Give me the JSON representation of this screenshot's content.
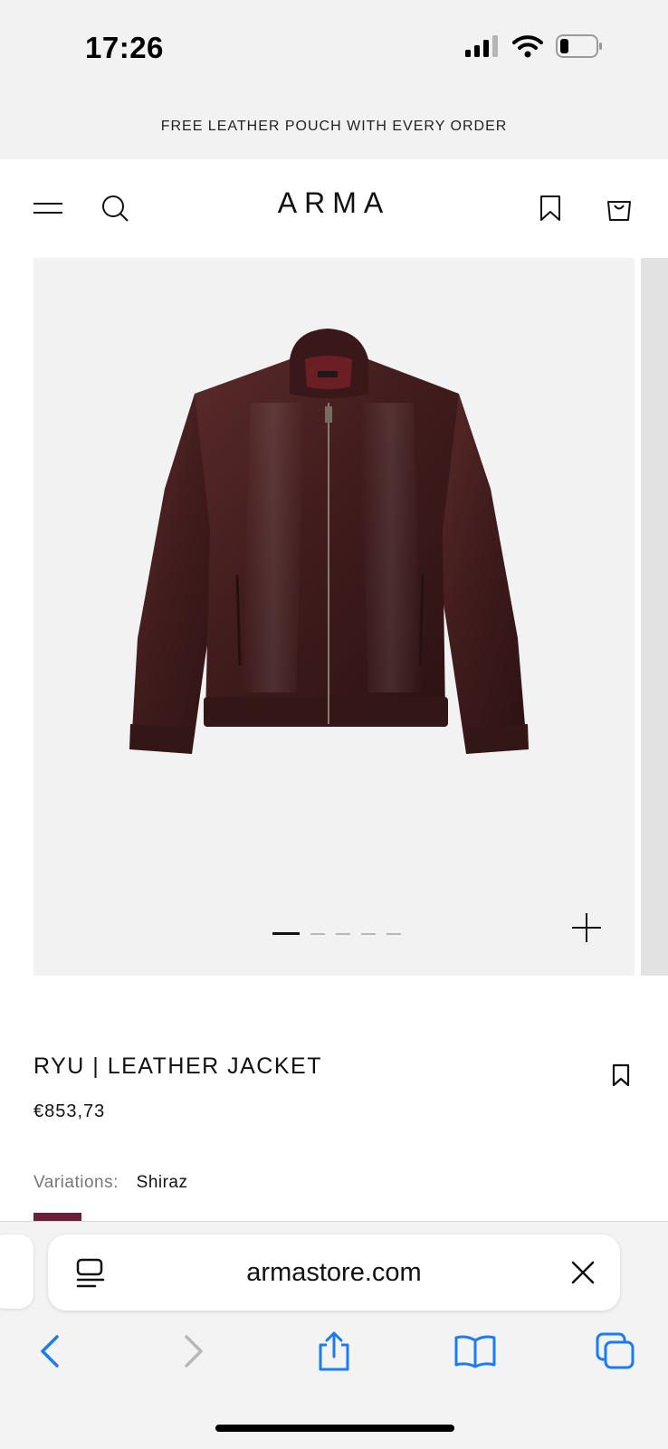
{
  "status_bar": {
    "time": "17:26"
  },
  "promo_banner": {
    "text": "FREE LEATHER POUCH WITH EVERY ORDER"
  },
  "header": {
    "brand": "ARMA"
  },
  "gallery": {
    "image_count": 5,
    "active_index": 0,
    "image_description_icon": "jacket-image"
  },
  "product": {
    "title": "RYU | LEATHER JACKET",
    "price": "€853,73",
    "variations_label": "Variations:",
    "variation_value": "Shiraz",
    "swatch_color": "#6e1f38"
  },
  "browser": {
    "url": "armastore.com"
  },
  "colors": {
    "accent_blue": "#1a7cf5",
    "banner_bg": "#f2f2f2"
  }
}
